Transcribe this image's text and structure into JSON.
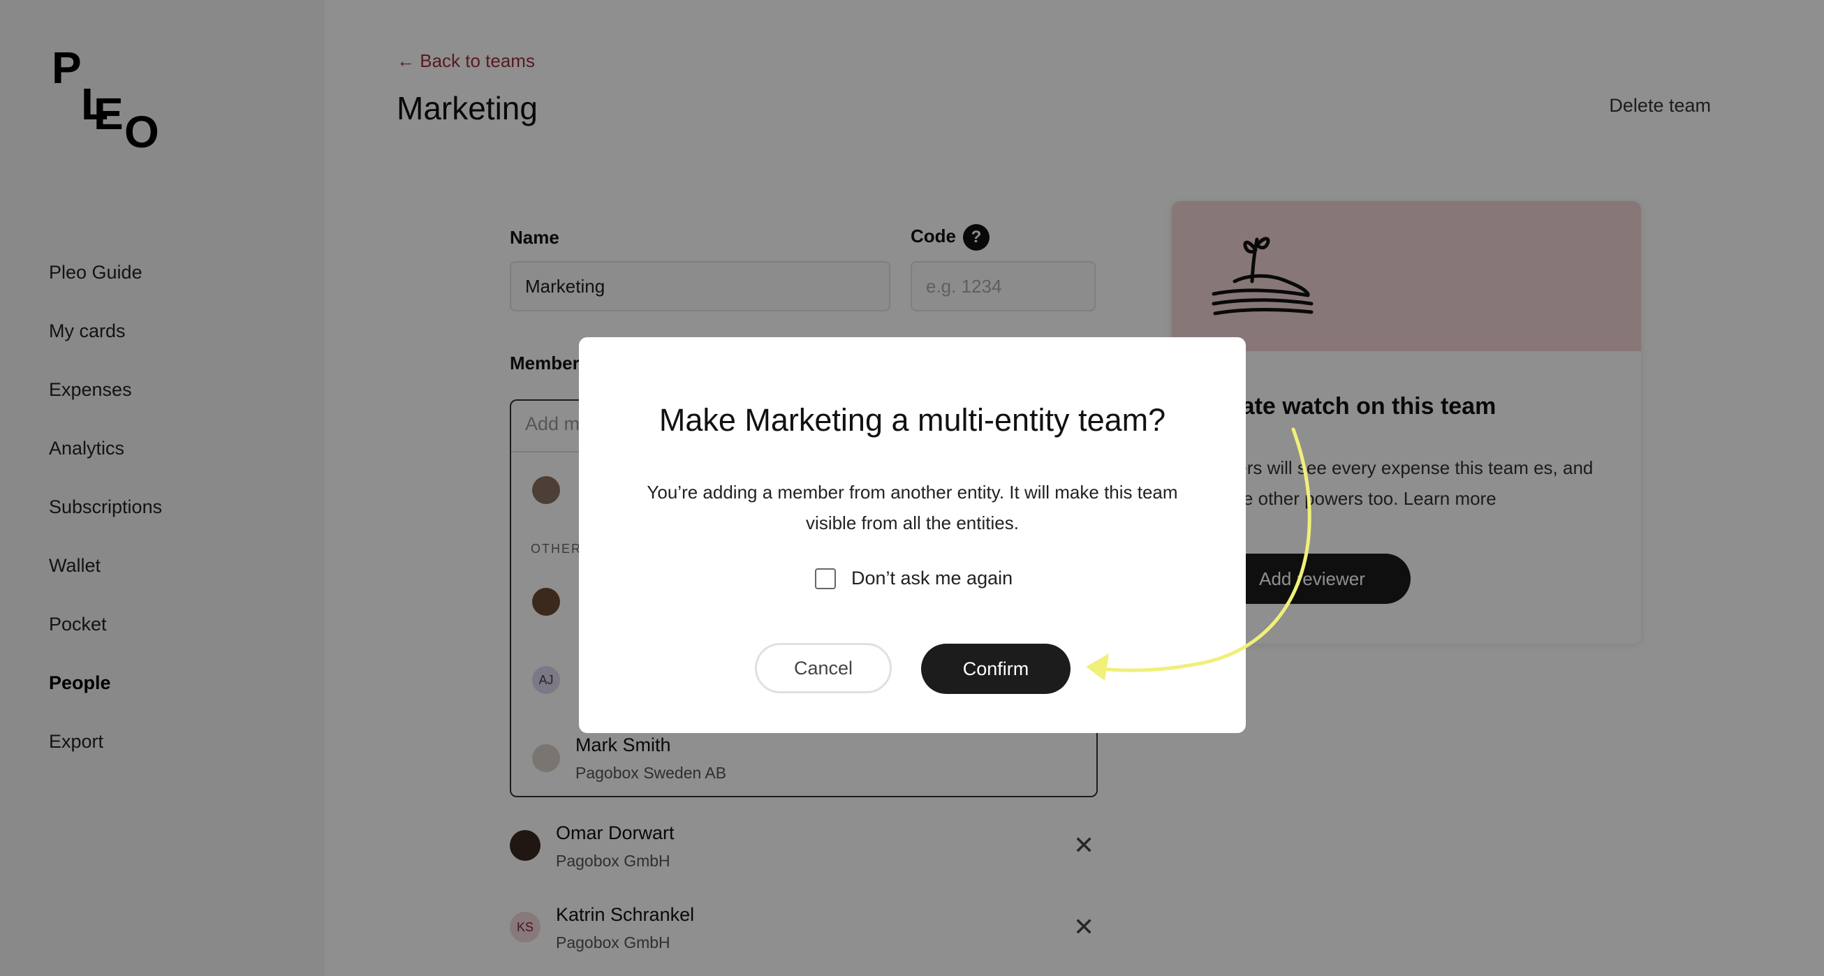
{
  "sidebar": {
    "logo_letters": [
      "P",
      "L",
      "E",
      "O"
    ],
    "items": [
      {
        "label": "Pleo Guide"
      },
      {
        "label": "My cards"
      },
      {
        "label": "Expenses"
      },
      {
        "label": "Analytics"
      },
      {
        "label": "Subscriptions"
      },
      {
        "label": "Wallet"
      },
      {
        "label": "Pocket"
      },
      {
        "label": "People"
      },
      {
        "label": "Export"
      }
    ],
    "active_item": "People"
  },
  "header": {
    "back_label": "← Back to teams",
    "title": "Marketing",
    "delete_label": "Delete team"
  },
  "form": {
    "name_label": "Name",
    "name_value": "Marketing",
    "code_label": "Code",
    "code_help": "?",
    "code_placeholder": "e.g. 1234",
    "members_label": "Member",
    "add_member_placeholder": "Add m",
    "other_label": "OTHER",
    "dropdown_rows": [
      {
        "initials": "AJ"
      },
      {
        "name": "Mark Smith",
        "entity": "Pagobox Sweden AB"
      }
    ],
    "members": [
      {
        "name": "Omar Dorwart",
        "entity": "Pagobox GmbH",
        "remove": "✕"
      },
      {
        "name": "Katrin Schrankel",
        "entity": "Pagobox GmbH",
        "initials": "KS",
        "remove": "✕"
      }
    ]
  },
  "card": {
    "title": "egate watch on this team",
    "text": "ewers will see every expense this team es, and have other powers too. Learn more",
    "button": "Add reviewer"
  },
  "modal": {
    "title": "Make Marketing a multi-entity team?",
    "body": "You’re adding a member from another entity. It will make this team visible from all the entities.",
    "checkbox_label": "Don’t ask me again",
    "cancel": "Cancel",
    "confirm": "Confirm"
  },
  "colors": {
    "accent": "#9c2f3f",
    "card_header": "#f2d4d4",
    "dark_button": "#1c1c1c",
    "annotation_arrow": "#f0f07a"
  }
}
